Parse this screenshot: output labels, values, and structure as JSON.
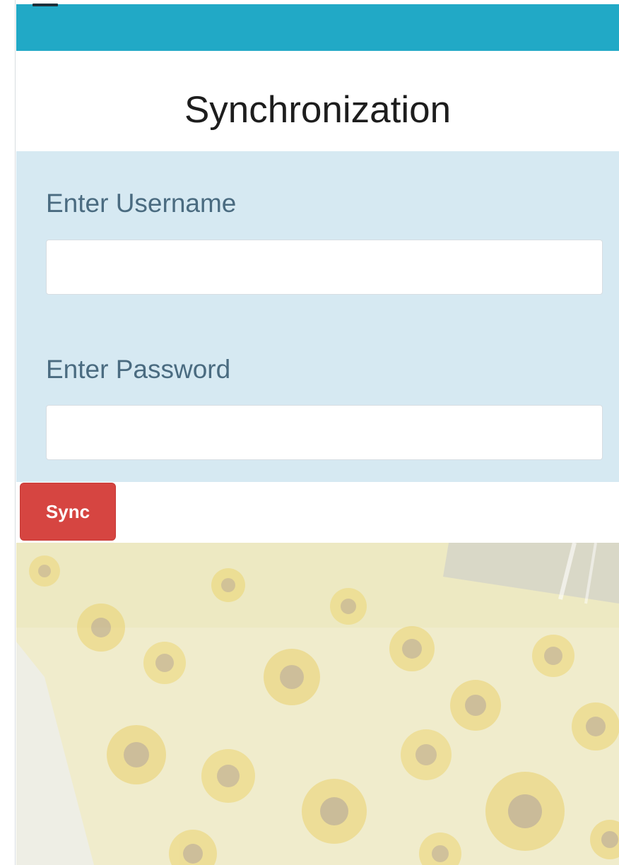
{
  "header": {
    "menu_icon": "hamburger-menu-icon",
    "accent_color": "#21a9c6"
  },
  "page": {
    "title": "Synchronization"
  },
  "form": {
    "username_label": "Enter Username",
    "username_value": "",
    "password_label": "Enter Password",
    "password_value": "",
    "panel_color": "#d6e9f2"
  },
  "actions": {
    "sync_label": "Sync",
    "sync_color": "#d64541"
  },
  "background": {
    "subject": "sunflower field with solar panels (faded)"
  }
}
